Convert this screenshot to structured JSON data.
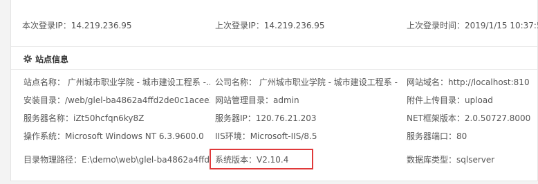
{
  "login": {
    "current_ip": "本次登录IP：14.219.236.95",
    "last_ip": "上次登录IP：14.219.236.95",
    "last_time": "上次登录时间：2019/1/15 10:37:58"
  },
  "site_info": {
    "title": "站点信息",
    "rows": [
      [
        "站点名称：  广州城市职业学院 - 城市建设工程系 -...",
        "公司名称：  广州城市职业学院 - 城市建设工程系 -...",
        "网站域名：http://localhost:810"
      ],
      [
        "安装目录：/web/glel-ba4862a4ffd2de0c1acee3...",
        "网站管理目录：admin",
        "附件上传目录：upload"
      ],
      [
        "服务器名称：iZt50hcfqn6ky8Z",
        "服务器IP：120.76.21.203",
        "NET框架版本：2.0.50727.8000"
      ],
      [
        "操作系统：Microsoft Windows NT 6.3.9600.0",
        "IIS环境：Microsoft-IIS/8.5",
        "服务器端口：80"
      ],
      [
        "目录物理路径：E:\\demo\\web\\glel-ba4862a4ffd...",
        "系统版本：V2.10.4",
        "数据库类型：sqlserver"
      ]
    ]
  },
  "colors": {
    "highlight": "#e0393a"
  },
  "icons": {
    "title_icon": "gear-icon"
  }
}
